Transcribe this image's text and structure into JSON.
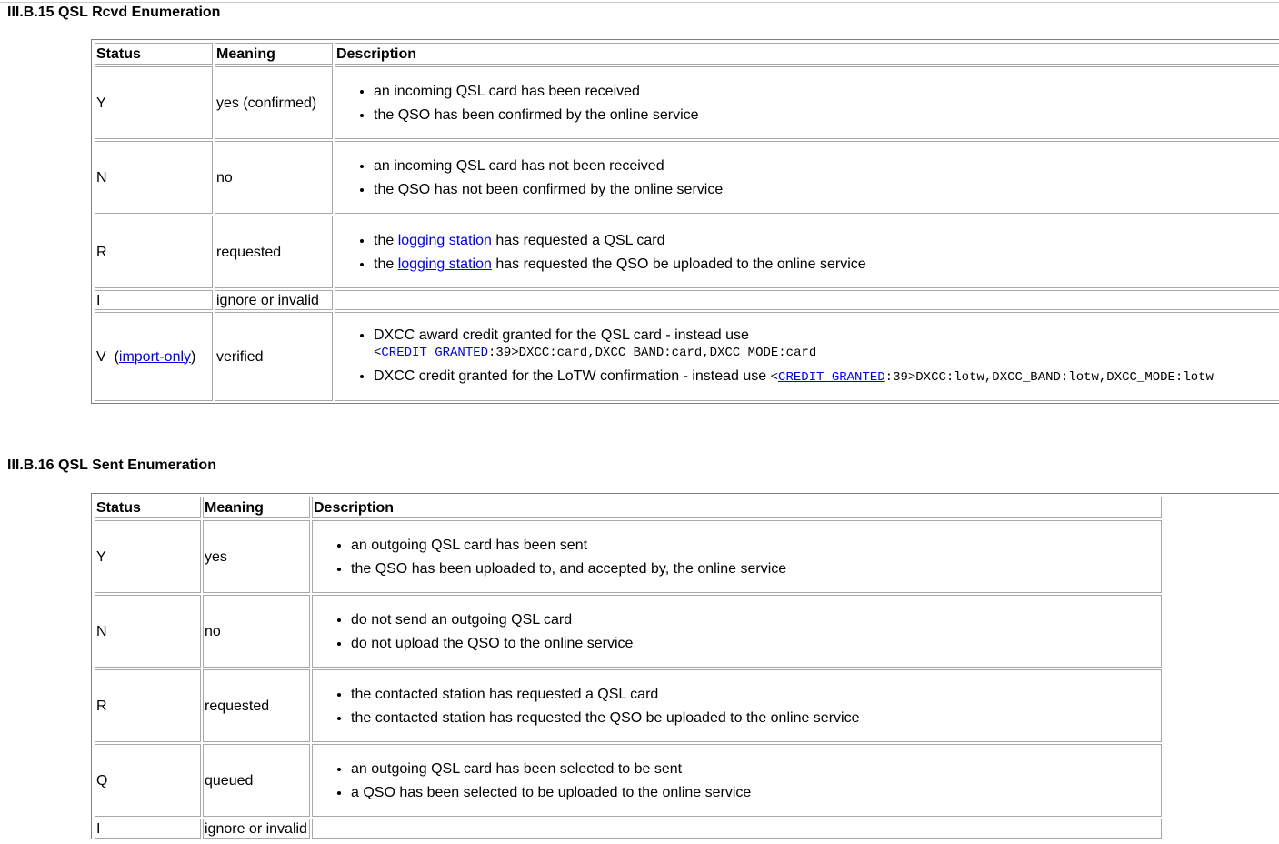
{
  "rcvd": {
    "title": "III.B.15 QSL Rcvd Enumeration",
    "headers": {
      "status": "Status",
      "meaning": "Meaning",
      "description": "Description"
    },
    "rows": [
      {
        "status": "Y",
        "meaning": "yes (confirmed)",
        "d1": "an incoming QSL card has been received",
        "d2": "the QSO has been confirmed by the online service"
      },
      {
        "status": "N",
        "meaning": "no",
        "d1": "an incoming QSL card has not been received",
        "d2": "the QSO has not been confirmed by the online service"
      },
      {
        "status": "R",
        "meaning": "requested",
        "d1_pre": "the ",
        "d1_link": "logging station",
        "d1_post": " has requested a QSL card",
        "d2_pre": "the ",
        "d2_link": "logging station",
        "d2_post": " has requested the QSO be uploaded to the online service"
      },
      {
        "status": "I",
        "meaning": "ignore or invalid"
      },
      {
        "status": "V",
        "status_link": "import-only",
        "meaning": "verified",
        "d1_text": "DXCC award credit granted for the QSL card - instead use",
        "d1_code_open": "<",
        "d1_code_link": "CREDIT_GRANTED",
        "d1_code_rest": ":39>DXCC:card,DXCC_BAND:card,DXCC_MODE:card",
        "d2_text": "DXCC credit granted for the LoTW confirmation - instead use ",
        "d2_code_open": "<",
        "d2_code_link": "CREDIT_GRANTED",
        "d2_code_rest": ":39>DXCC:lotw,DXCC_BAND:lotw,DXCC_MODE:lotw"
      }
    ]
  },
  "sent": {
    "title": "III.B.16 QSL Sent Enumeration",
    "headers": {
      "status": "Status",
      "meaning": "Meaning",
      "description": "Description"
    },
    "rows": [
      {
        "status": "Y",
        "meaning": "yes",
        "d1": "an outgoing QSL card has been sent",
        "d2": "the QSO has been uploaded to, and accepted by, the online service"
      },
      {
        "status": "N",
        "meaning": "no",
        "d1": "do not send an outgoing QSL card",
        "d2": "do not upload the QSO to the online service"
      },
      {
        "status": "R",
        "meaning": "requested",
        "d1": "the contacted station has requested a QSL card",
        "d2": "the contacted station has requested the QSO be uploaded to the online service"
      },
      {
        "status": "Q",
        "meaning": "queued",
        "d1": "an outgoing QSL card has been selected to be sent",
        "d2": "a QSO has been selected to be uploaded to the online service"
      },
      {
        "status": "I",
        "meaning": "ignore or invalid"
      }
    ]
  }
}
